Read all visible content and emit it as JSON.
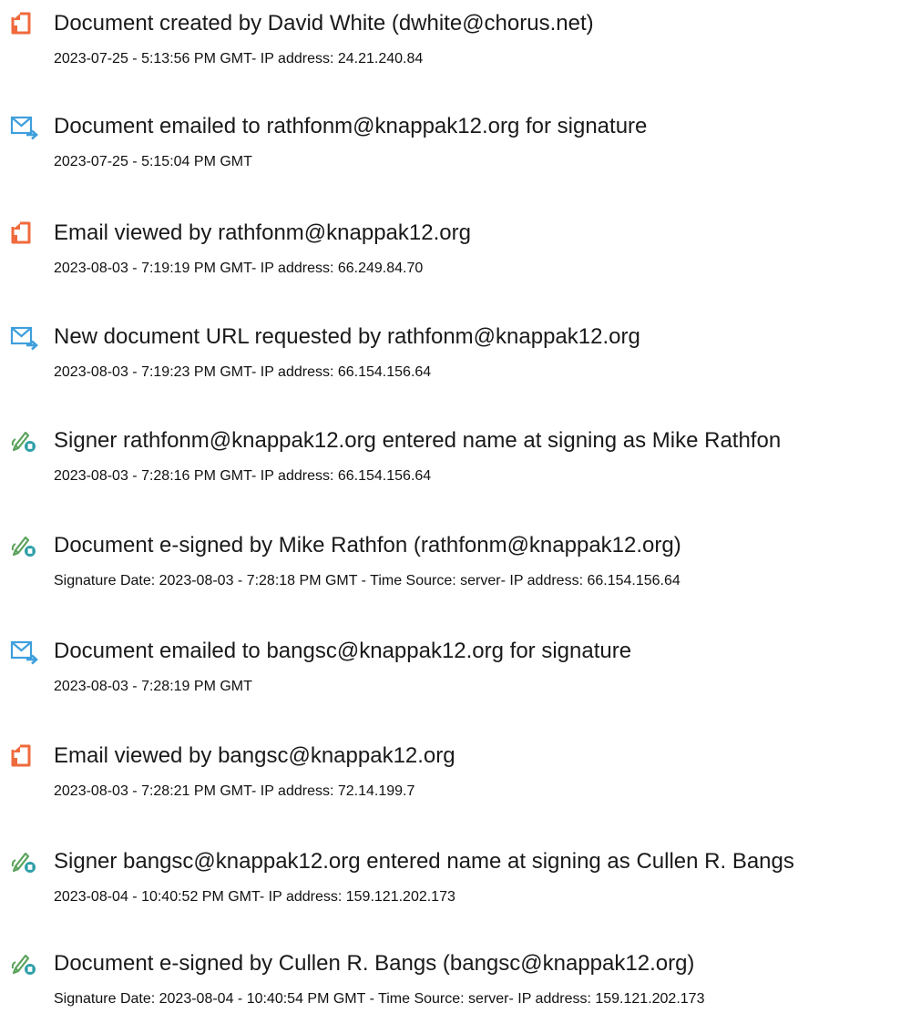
{
  "colors": {
    "document_icon": "#ef6a3c",
    "email_icon": "#3f9fdc",
    "signer_icon": "#5aa25b",
    "signer_badge": "#2f9fa8"
  },
  "events": [
    {
      "icon": "document-icon",
      "title": "Document created by David White (dwhite@chorus.net)",
      "detail": "2023-07-25 - 5:13:56 PM GMT- IP address: 24.21.240.84"
    },
    {
      "icon": "email-icon",
      "title": "Document emailed to rathfonm@knappak12.org for signature",
      "detail": "2023-07-25 - 5:15:04 PM GMT"
    },
    {
      "icon": "document-icon",
      "title": "Email viewed by rathfonm@knappak12.org",
      "detail": "2023-08-03 - 7:19:19 PM GMT- IP address: 66.249.84.70"
    },
    {
      "icon": "email-icon",
      "title": "New document URL requested by rathfonm@knappak12.org",
      "detail": "2023-08-03 - 7:19:23 PM GMT- IP address: 66.154.156.64"
    },
    {
      "icon": "signer-icon",
      "title": "Signer rathfonm@knappak12.org entered name at signing as Mike Rathfon",
      "detail": "2023-08-03 - 7:28:16 PM GMT- IP address: 66.154.156.64"
    },
    {
      "icon": "signer-icon",
      "title": "Document e-signed by Mike Rathfon (rathfonm@knappak12.org)",
      "detail": "Signature Date: 2023-08-03 - 7:28:18 PM GMT - Time Source: server- IP address: 66.154.156.64"
    },
    {
      "icon": "email-icon",
      "title": "Document emailed to bangsc@knappak12.org for signature",
      "detail": "2023-08-03 - 7:28:19 PM GMT"
    },
    {
      "icon": "document-icon",
      "title": "Email viewed by bangsc@knappak12.org",
      "detail": "2023-08-03 - 7:28:21 PM GMT- IP address: 72.14.199.7"
    },
    {
      "icon": "signer-icon",
      "title": "Signer bangsc@knappak12.org entered name at signing as Cullen R. Bangs",
      "detail": "2023-08-04 - 10:40:52 PM GMT- IP address: 159.121.202.173"
    },
    {
      "icon": "signer-icon",
      "title": "Document e-signed by Cullen R. Bangs (bangsc@knappak12.org)",
      "detail": "Signature Date: 2023-08-04 - 10:40:54 PM GMT - Time Source: server- IP address: 159.121.202.173"
    }
  ]
}
